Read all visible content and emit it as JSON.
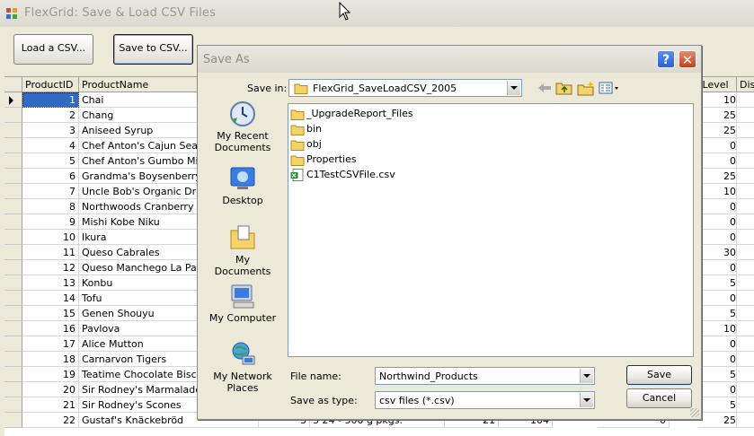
{
  "window": {
    "title": "FlexGrid: Save & Load CSV Files"
  },
  "buttons": {
    "load": "Load a CSV...",
    "save": "Save to CSV..."
  },
  "grid": {
    "columns": {
      "product_id": "ProductID",
      "product_name": "ProductName",
      "reorder_level": "rLevel",
      "disc": "Dis"
    },
    "rows": [
      {
        "id": "1",
        "name": "Chai",
        "level": "10"
      },
      {
        "id": "2",
        "name": "Chang",
        "level": "25"
      },
      {
        "id": "3",
        "name": "Aniseed Syrup",
        "level": "25"
      },
      {
        "id": "4",
        "name": "Chef Anton's Cajun Seasoning",
        "level": "0"
      },
      {
        "id": "5",
        "name": "Chef Anton's Gumbo Mix",
        "level": "0"
      },
      {
        "id": "6",
        "name": "Grandma's Boysenberry Spread",
        "level": "25"
      },
      {
        "id": "7",
        "name": "Uncle Bob's Organic Dried Pears",
        "level": "10"
      },
      {
        "id": "8",
        "name": "Northwoods Cranberry Sauce",
        "level": "0"
      },
      {
        "id": "9",
        "name": "Mishi Kobe Niku",
        "level": "0"
      },
      {
        "id": "10",
        "name": "Ikura",
        "level": "0"
      },
      {
        "id": "11",
        "name": "Queso Cabrales",
        "level": "30"
      },
      {
        "id": "12",
        "name": "Queso Manchego La Pastora",
        "level": "0"
      },
      {
        "id": "13",
        "name": "Konbu",
        "level": "5"
      },
      {
        "id": "14",
        "name": "Tofu",
        "level": "0"
      },
      {
        "id": "15",
        "name": "Genen Shouyu",
        "level": "5"
      },
      {
        "id": "16",
        "name": "Pavlova",
        "level": "10"
      },
      {
        "id": "17",
        "name": "Alice Mutton",
        "level": "0"
      },
      {
        "id": "18",
        "name": "Carnarvon Tigers",
        "level": "0"
      },
      {
        "id": "19",
        "name": "Teatime Chocolate Biscuits",
        "level": "5"
      },
      {
        "id": "20",
        "name": "Sir Rodney's Marmalade",
        "level": "0"
      },
      {
        "id": "21",
        "name": "Sir Rodney's Scones",
        "level": "5"
      },
      {
        "id": "22",
        "name": "Gustaf's Knäckebröd",
        "level": "25"
      }
    ],
    "partial_last_row": {
      "c1": "3",
      "c2": "3",
      "c3": "24 - 500 g pkgs.",
      "c4": "21",
      "c5": "104",
      "c6": "0"
    }
  },
  "dialog": {
    "title": "Save As",
    "help": "?",
    "close": "✕",
    "save_in_label": "Save in:",
    "save_in_value": "FlexGrid_SaveLoadCSV_2005",
    "places": [
      {
        "label": "My Recent Documents",
        "icon": "recent-documents-icon"
      },
      {
        "label": "Desktop",
        "icon": "desktop-icon"
      },
      {
        "label": "My Documents",
        "icon": "my-documents-icon"
      },
      {
        "label": "My Computer",
        "icon": "my-computer-icon"
      },
      {
        "label": "My Network Places",
        "icon": "network-places-icon"
      }
    ],
    "files": [
      {
        "name": "_UpgradeReport_Files",
        "type": "folder"
      },
      {
        "name": "bin",
        "type": "folder"
      },
      {
        "name": "obj",
        "type": "folder"
      },
      {
        "name": "Properties",
        "type": "folder"
      },
      {
        "name": "C1TestCSVFile.csv",
        "type": "csv"
      }
    ],
    "file_name_label": "File name:",
    "file_name_value": "Northwind_Products",
    "save_type_label": "Save as type:",
    "save_type_value": "csv files (*.csv)",
    "save_button": "Save",
    "cancel_button": "Cancel",
    "colors": {
      "folder": "#f5d36a",
      "selection": "#316ac5"
    }
  }
}
